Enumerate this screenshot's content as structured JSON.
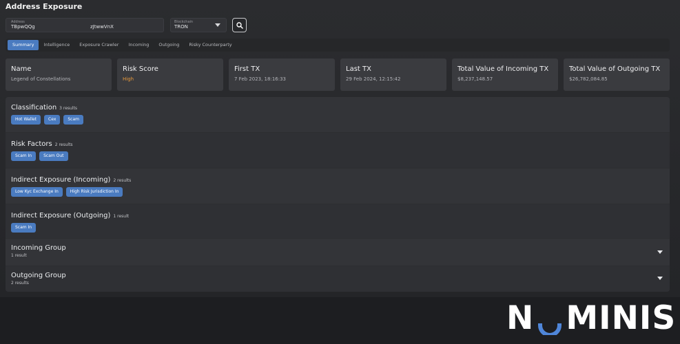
{
  "page": {
    "title": "Address Exposure"
  },
  "search": {
    "address_label": "Address",
    "address_value_start": "TBpwQQg",
    "address_value_end": "zJtwwVnX",
    "chain_label": "Blockchain",
    "chain_value": "TRON"
  },
  "tabs": [
    {
      "label": "Summary",
      "active": true
    },
    {
      "label": "Intelligence"
    },
    {
      "label": "Exposure Crawler"
    },
    {
      "label": "Incoming"
    },
    {
      "label": "Outgoing"
    },
    {
      "label": "Risky Counterparty"
    }
  ],
  "cards": [
    {
      "title": "Name",
      "value": "Legend of Constellations"
    },
    {
      "title": "Risk Score",
      "value": "High"
    },
    {
      "title": "First TX",
      "value": "7 Feb 2023, 18:16:33"
    },
    {
      "title": "Last TX",
      "value": "29 Feb 2024, 12:15:42"
    },
    {
      "title": "Total Value of Incoming TX",
      "value": "$8,237,148.57"
    },
    {
      "title": "Total Value of Outgoing TX",
      "value": "$26,782,084.85"
    }
  ],
  "sections": {
    "classification": {
      "title": "Classification",
      "count": "3 results",
      "chips": [
        "Hot Wallet",
        "Cex",
        "Scam"
      ]
    },
    "risk_factors": {
      "title": "Risk Factors",
      "count": "2 results",
      "chips": [
        "Scam In",
        "Scam Out"
      ]
    },
    "indirect_in": {
      "title": "Indirect Exposure (Incoming)",
      "count": "2 results",
      "chips": [
        "Low Kyc Exchange In",
        "High Risk Jurisdiction In"
      ]
    },
    "indirect_out": {
      "title": "Indirect Exposure (Outgoing)",
      "count": "1 result",
      "chips": [
        "Scam In"
      ]
    },
    "incoming_group": {
      "title": "Incoming Group",
      "count": "1 result"
    },
    "outgoing_group": {
      "title": "Outgoing Group",
      "count": "2 results"
    }
  },
  "brand": {
    "left": "N",
    "right": "MINIS"
  },
  "colors": {
    "accent": "#4a7bc0",
    "risk_high": "#e89a3d",
    "logo_o": "#4f86d9"
  }
}
